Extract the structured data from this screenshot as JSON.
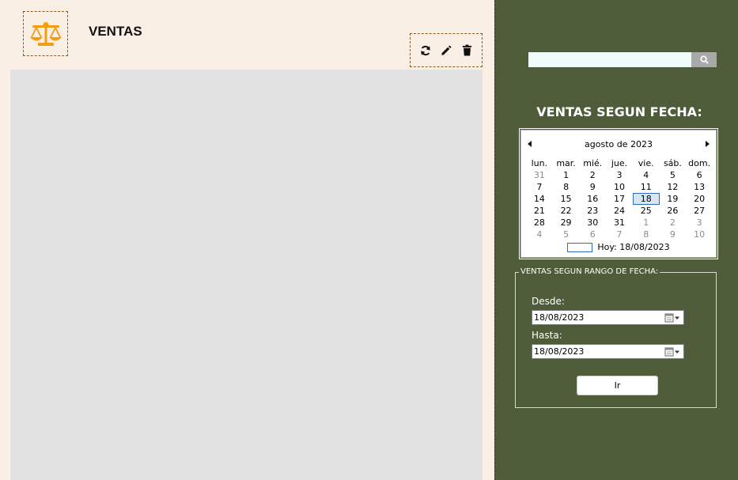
{
  "header": {
    "title": "VENTAS"
  },
  "toolbar": {
    "refresh_icon": "refresh-icon",
    "edit_icon": "pencil-icon",
    "delete_icon": "trash-icon"
  },
  "search": {
    "value": "",
    "placeholder": ""
  },
  "sidebar": {
    "date_title": "VENTAS SEGUN FECHA:",
    "calendar": {
      "month_label": "agosto de 2023",
      "weekdays": [
        "lun.",
        "mar.",
        "mié.",
        "jue.",
        "vie.",
        "sáb.",
        "dom."
      ],
      "weeks": [
        [
          "31",
          "1",
          "2",
          "3",
          "4",
          "5",
          "6"
        ],
        [
          "7",
          "8",
          "9",
          "10",
          "11",
          "12",
          "13"
        ],
        [
          "14",
          "15",
          "16",
          "17",
          "18",
          "19",
          "20"
        ],
        [
          "21",
          "22",
          "23",
          "24",
          "25",
          "26",
          "27"
        ],
        [
          "28",
          "29",
          "30",
          "31",
          "1",
          "2",
          "3"
        ],
        [
          "4",
          "5",
          "6",
          "7",
          "8",
          "9",
          "10"
        ]
      ],
      "selected_day": "18",
      "today_label": "Hoy: 18/08/2023"
    },
    "range": {
      "legend": "VENTAS SEGUN RANGO DE FECHA:",
      "from_label": "Desde:",
      "from_value": "18/08/2023",
      "to_label": "Hasta:",
      "to_value": "18/08/2023",
      "go_label": "Ir"
    }
  },
  "colors": {
    "left_bg": "#f9efe4",
    "right_bg": "#4e5c39",
    "grid_bg": "#e2e2e2",
    "logo_accent": "#f39c12"
  }
}
